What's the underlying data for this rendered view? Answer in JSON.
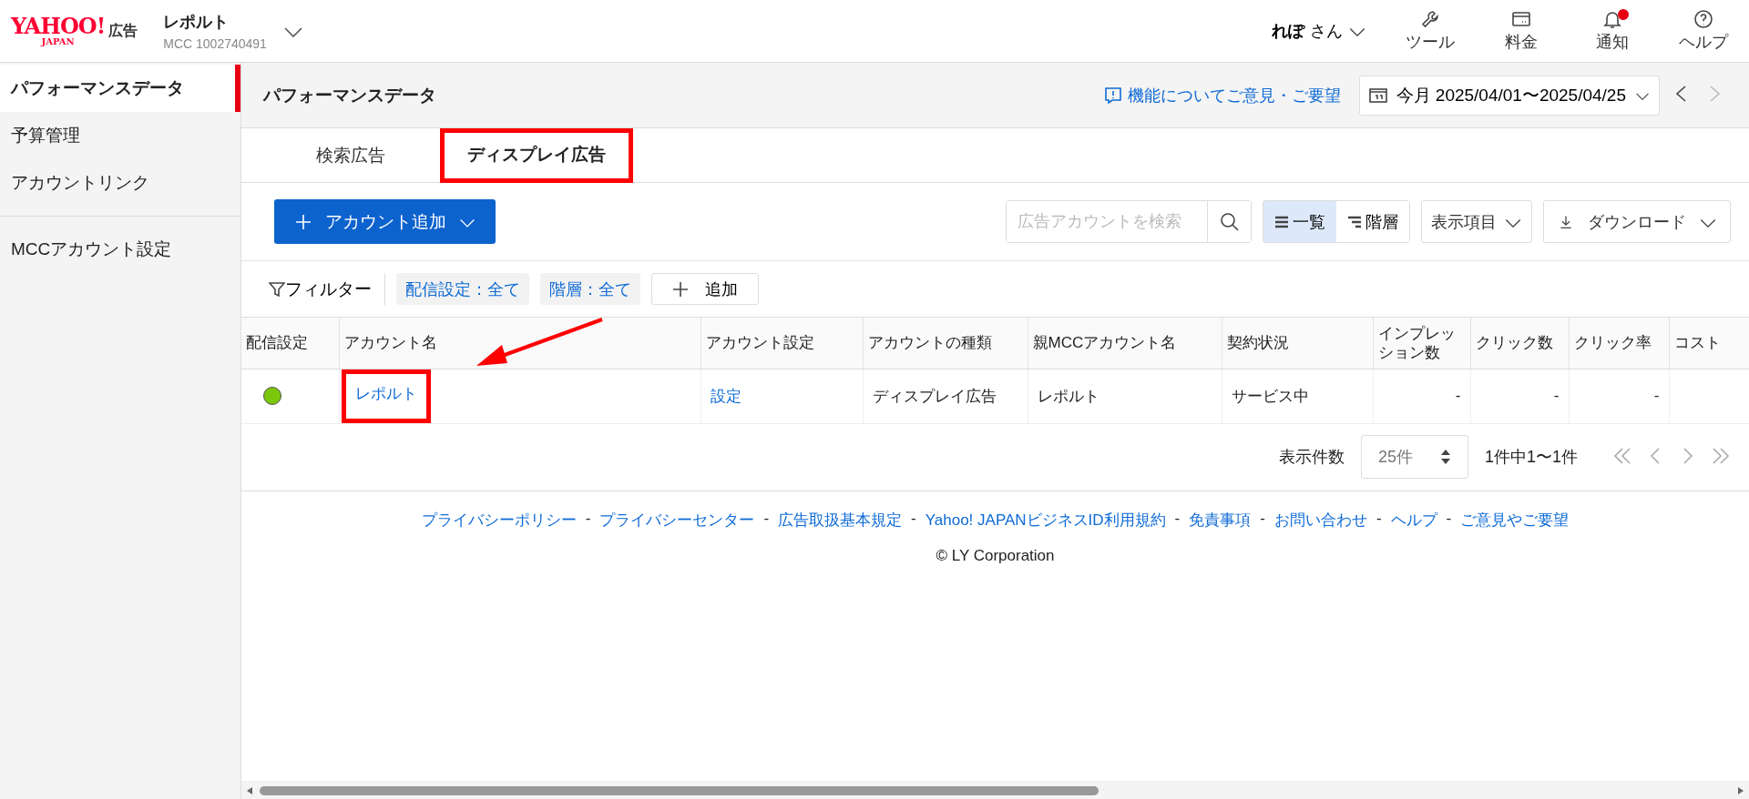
{
  "header": {
    "logo": {
      "text": "YAHOO!",
      "sub": "JAPAN",
      "suffix": "広告"
    },
    "account": {
      "name": "レポルト",
      "id": "MCC 1002740491"
    },
    "user": {
      "name": "れぽ",
      "honorific": "さん"
    },
    "tools": [
      {
        "kind": "wrench",
        "label": "ツール",
        "badge": false
      },
      {
        "kind": "billing",
        "label": "料金",
        "badge": false
      },
      {
        "kind": "bell",
        "label": "通知",
        "badge": true
      },
      {
        "kind": "help",
        "label": "ヘルプ",
        "badge": false
      }
    ]
  },
  "sidebar": {
    "groups": [
      {
        "items": [
          {
            "label": "パフォーマンスデータ",
            "selected": true
          },
          {
            "label": "予算管理",
            "selected": false
          },
          {
            "label": "アカウントリンク",
            "selected": false
          }
        ]
      },
      {
        "items": [
          {
            "label": "MCCアカウント設定",
            "selected": false
          }
        ]
      }
    ]
  },
  "page": {
    "title": "パフォーマンスデータ",
    "feedback": "機能についてご意見・ご要望",
    "period": {
      "label": "今月",
      "range": "2025/04/01〜2025/04/25"
    },
    "prev_disabled": false,
    "next_disabled": true
  },
  "tabs": [
    {
      "label": "検索広告",
      "selected": false,
      "annotated": false
    },
    {
      "label": "ディスプレイ広告",
      "selected": true,
      "annotated": true
    }
  ],
  "toolbar": {
    "add_button": "アカウント追加",
    "search": {
      "placeholder": "広告アカウントを検索"
    },
    "views": [
      {
        "kind": "list",
        "label": "一覧",
        "selected": true
      },
      {
        "kind": "tree",
        "label": "階層",
        "selected": false
      }
    ],
    "columns_button": "表示項目",
    "download_button": "ダウンロード"
  },
  "filters": {
    "label": "フィルター",
    "chips": [
      "配信設定：全て",
      "階層：全て"
    ],
    "add": "追加"
  },
  "table": {
    "columns": [
      "配信設定",
      "アカウント名",
      "アカウント設定",
      "アカウントの種類",
      "親MCCアカウント名",
      "契約状況",
      "インプレッション数",
      "クリック数",
      "クリック率",
      "コスト"
    ],
    "rows": [
      {
        "color": "#7ac70c",
        "name": "レポルト",
        "name_annotated": true,
        "settings": "設定",
        "type": "ディスプレイ広告",
        "parent": "レポルト",
        "contract": "サービス中",
        "impressions": "-",
        "clicks": "-",
        "ctr": "-"
      }
    ]
  },
  "pagination": {
    "per_page_label": "表示件数",
    "per_page": "25件",
    "range": "1件中1〜1件"
  },
  "footer": {
    "links": [
      "プライバシーポリシー",
      "プライバシーセンター",
      "広告取扱基本規定",
      "Yahoo! JAPANビジネスID利用規約",
      "免責事項",
      "お問い合わせ",
      "ヘルプ",
      "ご意見やご要望"
    ],
    "separator": "-",
    "copyright": "© LY Corporation"
  }
}
